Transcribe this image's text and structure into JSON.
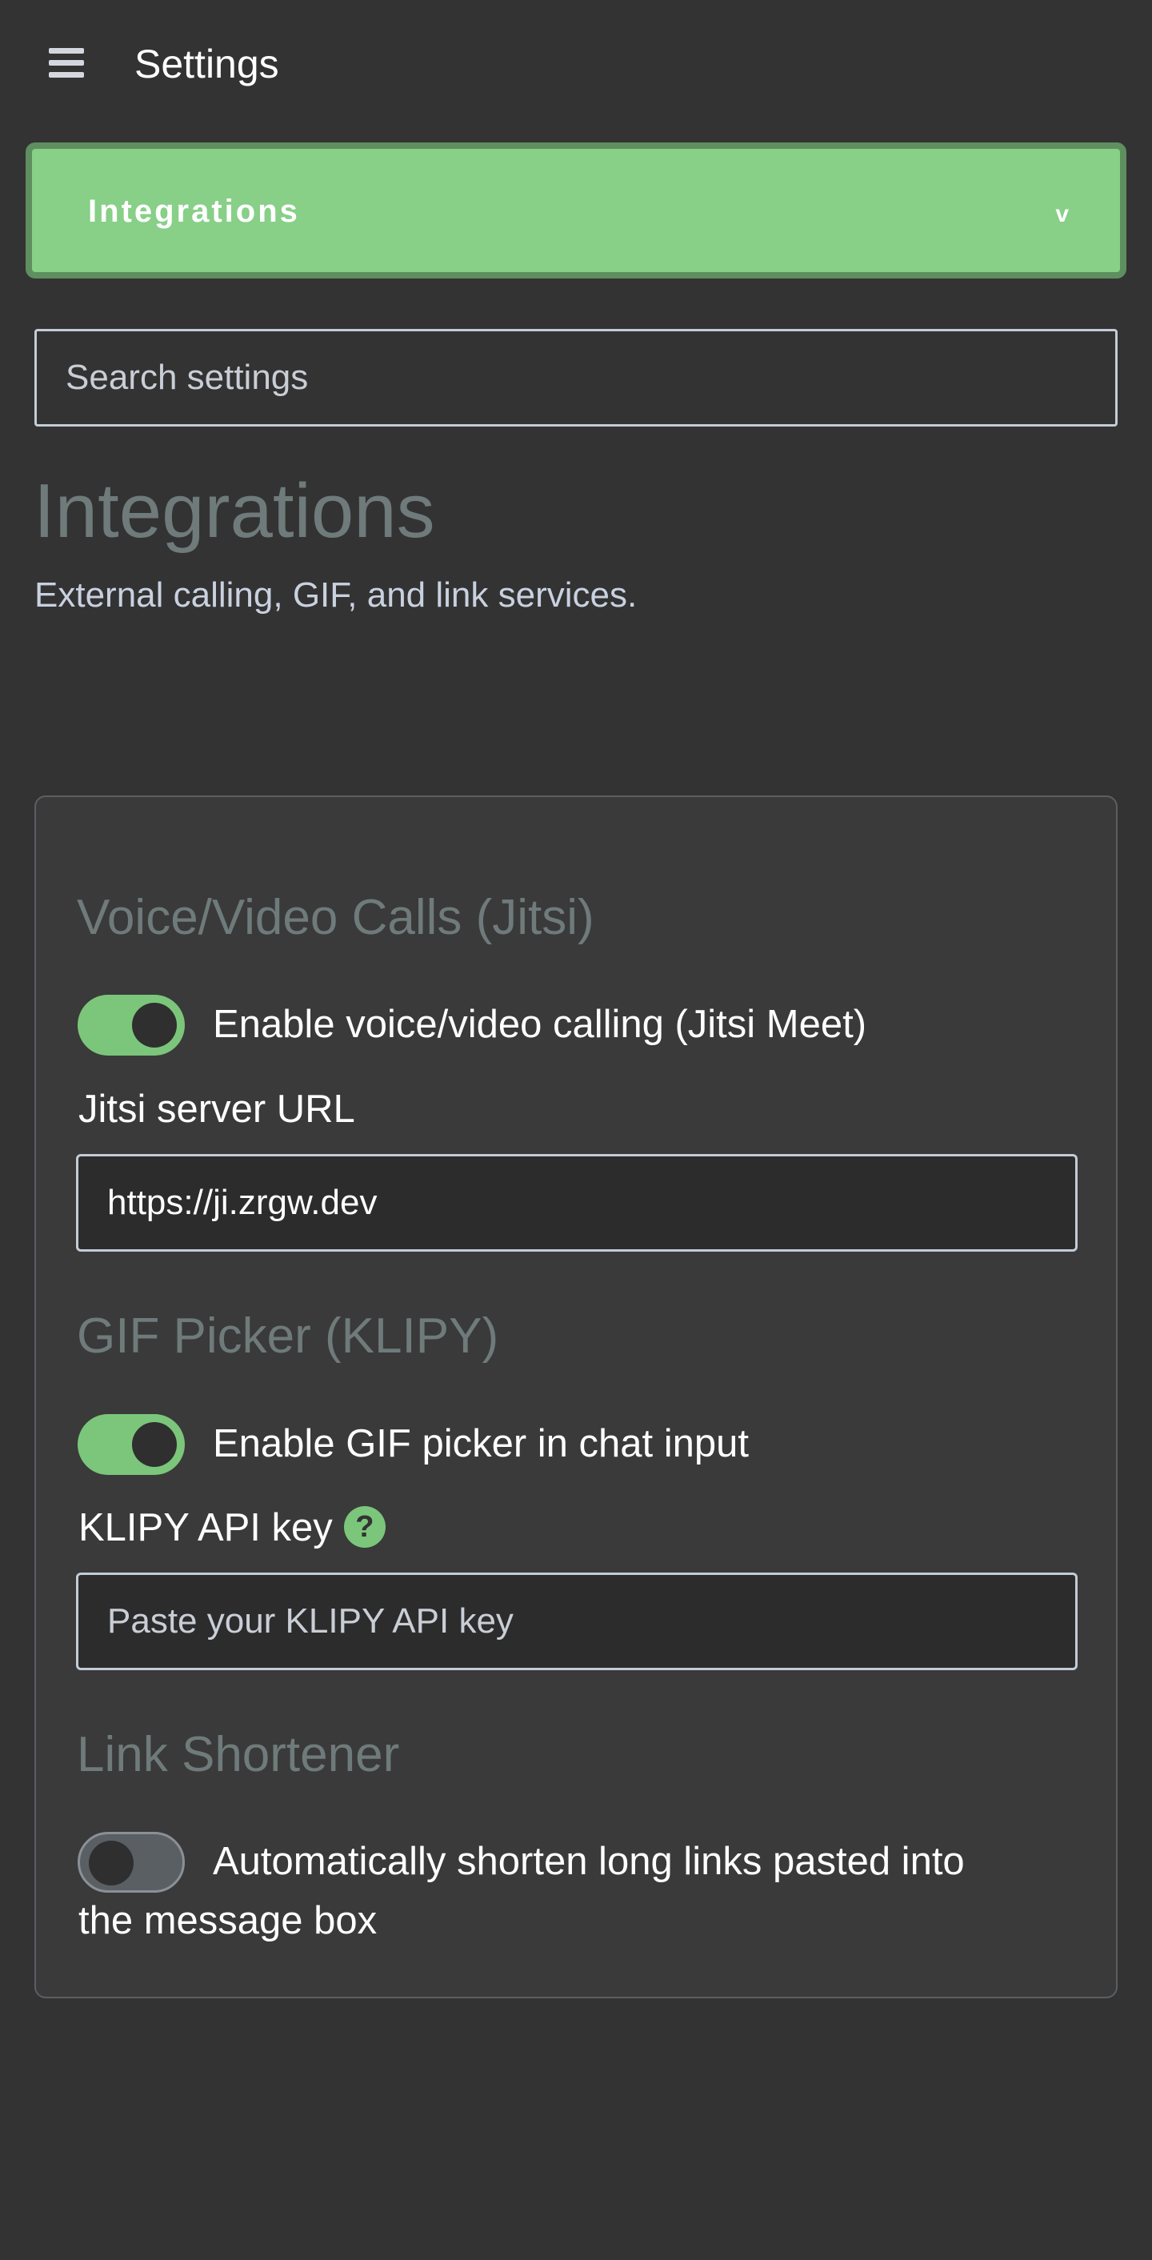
{
  "header": {
    "menu_icon": "hamburger-menu-icon",
    "title": "Settings"
  },
  "category_select": {
    "selected": "Integrations",
    "chevron": "v",
    "background_color": "#88cf88"
  },
  "search": {
    "placeholder": "Search settings",
    "value": ""
  },
  "page": {
    "title": "Integrations",
    "subtitle": "External calling, GIF, and link services."
  },
  "sections": {
    "jitsi": {
      "heading": "Voice/Video Calls (Jitsi)",
      "toggle_label": "Enable voice/video calling (Jitsi Meet)",
      "toggle_on": true,
      "url_label": "Jitsi server URL",
      "url_value": "https://ji.zrgw.dev"
    },
    "gif": {
      "heading": "GIF Picker (KLIPY)",
      "toggle_label": "Enable GIF picker in chat input",
      "toggle_on": true,
      "api_key_label": "KLIPY API key",
      "help_icon_glyph": "?",
      "api_key_placeholder": "Paste your KLIPY API key",
      "api_key_value": ""
    },
    "link_shortener": {
      "heading": "Link Shortener",
      "toggle_label_line1": "Automatically shorten long links pasted into",
      "toggle_label_line2": "the message box",
      "toggle_on": false
    }
  },
  "colors": {
    "background": "#333333",
    "accent_green": "#7bc67b",
    "heading_gray": "#6f7a7a"
  }
}
